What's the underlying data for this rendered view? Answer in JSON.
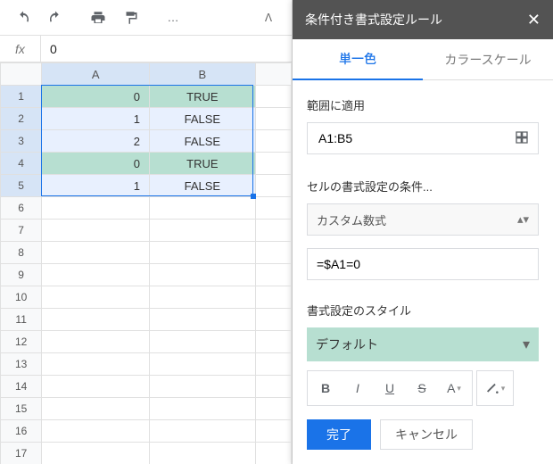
{
  "toolbar": {
    "more": "…"
  },
  "fx": {
    "label": "fx",
    "value": "0"
  },
  "columns": [
    "A",
    "B"
  ],
  "rows": [
    {
      "n": 1,
      "a": "0",
      "b": "TRUE",
      "hl": true
    },
    {
      "n": 2,
      "a": "1",
      "b": "FALSE",
      "hl": false
    },
    {
      "n": 3,
      "a": "2",
      "b": "FALSE",
      "hl": false
    },
    {
      "n": 4,
      "a": "0",
      "b": "TRUE",
      "hl": true
    },
    {
      "n": 5,
      "a": "1",
      "b": "FALSE",
      "hl": false
    },
    {
      "n": 6,
      "a": "",
      "b": "",
      "hl": false
    },
    {
      "n": 7,
      "a": "",
      "b": "",
      "hl": false
    },
    {
      "n": 8,
      "a": "",
      "b": "",
      "hl": false
    },
    {
      "n": 9,
      "a": "",
      "b": "",
      "hl": false
    },
    {
      "n": 10,
      "a": "",
      "b": "",
      "hl": false
    },
    {
      "n": 11,
      "a": "",
      "b": "",
      "hl": false
    },
    {
      "n": 12,
      "a": "",
      "b": "",
      "hl": false
    },
    {
      "n": 13,
      "a": "",
      "b": "",
      "hl": false
    },
    {
      "n": 14,
      "a": "",
      "b": "",
      "hl": false
    },
    {
      "n": 15,
      "a": "",
      "b": "",
      "hl": false
    },
    {
      "n": 16,
      "a": "",
      "b": "",
      "hl": false
    },
    {
      "n": 17,
      "a": "",
      "b": "",
      "hl": false
    }
  ],
  "panel": {
    "title": "条件付き書式設定ルール",
    "tabs": {
      "single": "単一色",
      "scale": "カラースケール"
    },
    "apply_range_label": "範囲に適用",
    "apply_range_value": "A1:B5",
    "format_if_label": "セルの書式設定の条件...",
    "format_if_value": "カスタム数式",
    "formula_value": "=$A1=0",
    "style_label": "書式設定のスタイル",
    "style_preview": "デフォルト",
    "done": "完了",
    "cancel": "キャンセル"
  }
}
